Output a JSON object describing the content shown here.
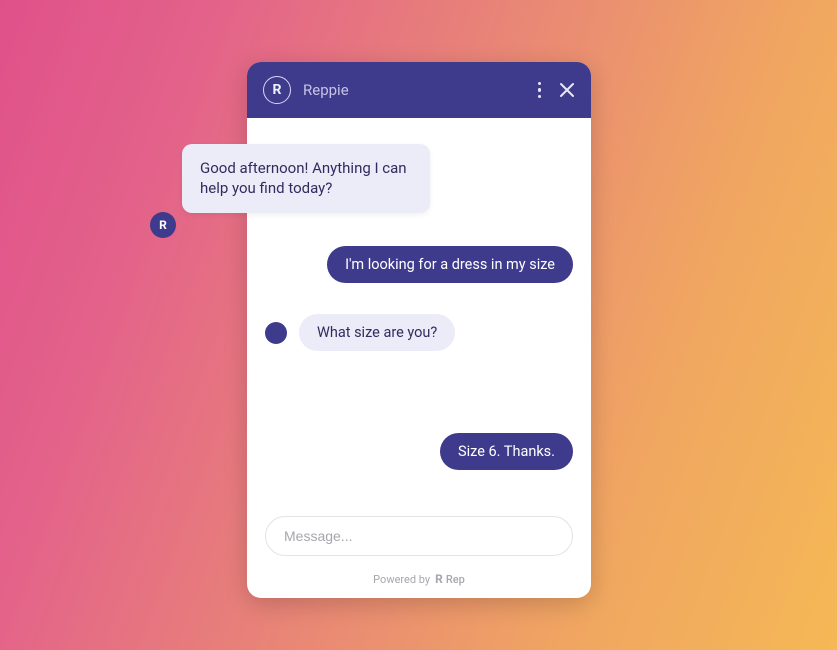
{
  "header": {
    "brand_letter": "R",
    "title": "Reppie"
  },
  "messages": {
    "bot_1": "Good afternoon! Anything I can help you find today?",
    "user_1": "I'm looking for a dress in my size",
    "bot_2": "What size are you?",
    "user_2": "Size 6. Thanks."
  },
  "input": {
    "placeholder": "Message..."
  },
  "footer": {
    "prefix": "Powered by",
    "brand_mark": "R",
    "brand_name": "Rep"
  },
  "colors": {
    "accent": "#3e3a8c",
    "bot_bubble": "#ecebf8"
  }
}
